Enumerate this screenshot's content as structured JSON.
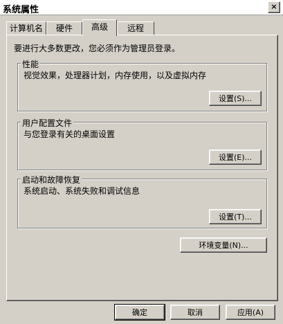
{
  "window": {
    "title": "系统属性",
    "close_label": "×"
  },
  "tabs": [
    {
      "label": "计算机名"
    },
    {
      "label": "硬件"
    },
    {
      "label": "高级",
      "active": true
    },
    {
      "label": "远程"
    }
  ],
  "advanced": {
    "admin_note": "要进行大多数更改，您必须作为管理员登录。",
    "performance": {
      "title": "性能",
      "description": "视觉效果，处理器计划，内存使用，以及虚拟内存",
      "button": "设置(S)..."
    },
    "user_profiles": {
      "title": "用户配置文件",
      "description": "与您登录有关的桌面设置",
      "button": "设置(E)..."
    },
    "startup_recovery": {
      "title": "启动和故障恢复",
      "description": "系统启动、系统失败和调试信息",
      "button": "设置(T)..."
    },
    "env_vars_button": "环境变量(N)..."
  },
  "footer": {
    "ok": "确定",
    "cancel": "取消",
    "apply": "应用(A)"
  }
}
